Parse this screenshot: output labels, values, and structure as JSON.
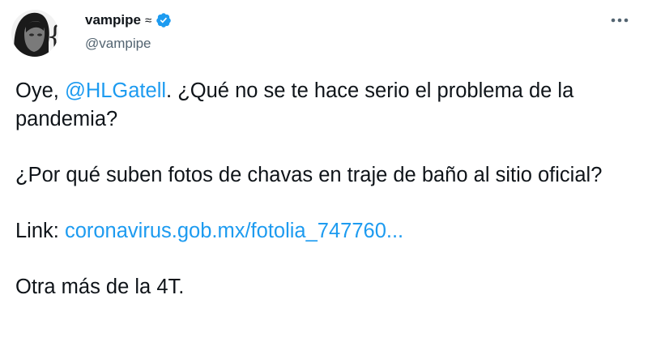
{
  "author": {
    "display_name": "vampipe",
    "name_suffix": "≈",
    "handle": "@vampipe",
    "verified": true
  },
  "tweet": {
    "p1_a": "Oye, ",
    "mention": "@HLGatell",
    "p1_b": ". ¿Qué no se te hace serio el problema de la pandemia?",
    "p2": "¿Por qué suben fotos de chavas en traje de baño al sitio oficial?",
    "p3_label": "Link: ",
    "p3_link": "coronavirus.gob.mx/fotolia_747760...",
    "p4": "Otra más de la 4T."
  },
  "icons": {
    "verified": "verified-badge-icon",
    "more": "more-options-icon"
  },
  "colors": {
    "link": "#1d9bf0",
    "text": "#0f1419",
    "secondary": "#536471",
    "verified": "#1d9bf0"
  }
}
